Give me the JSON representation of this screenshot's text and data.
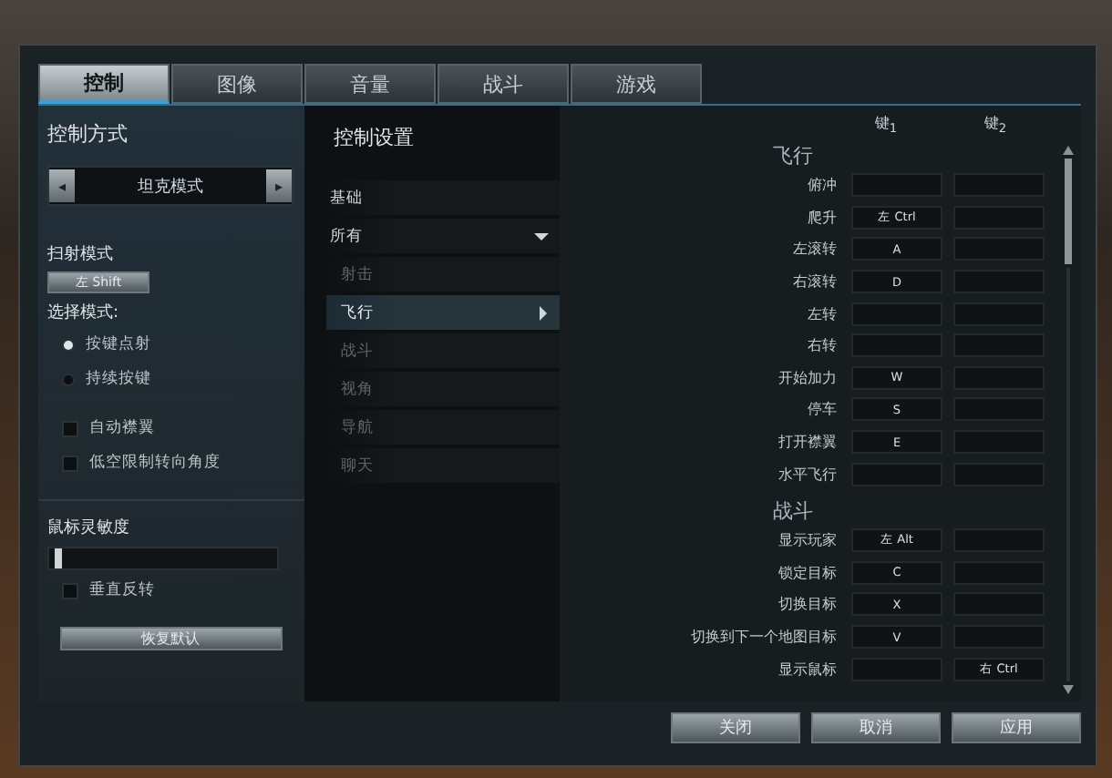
{
  "tabs": [
    {
      "label": "控制",
      "selected": true
    },
    {
      "label": "图像",
      "selected": false
    },
    {
      "label": "音量",
      "selected": false
    },
    {
      "label": "战斗",
      "selected": false
    },
    {
      "label": "游戏",
      "selected": false
    }
  ],
  "left": {
    "mode_title": "控制方式",
    "mode_prev": "◂",
    "mode_value": "坦克模式",
    "mode_next": "▸",
    "strafe_title": "扫射模式",
    "strafe_key": "左 Shift",
    "select_title": "选择模式:",
    "radios": [
      {
        "label": "按键点射",
        "selected": true
      },
      {
        "label": "持续按键",
        "selected": false
      }
    ],
    "checks": [
      {
        "label": "自动襟翼",
        "checked": false
      },
      {
        "label": "低空限制转向角度",
        "checked": false
      }
    ],
    "sensitivity_title": "鼠标灵敏度",
    "sensitivity": {
      "level": 0.02
    },
    "invert": {
      "label": "垂直反转",
      "checked": false
    },
    "reset": "恢复默认"
  },
  "middle": {
    "title": "控制设置",
    "items": [
      {
        "label": "基础",
        "selected": false
      },
      {
        "label": "所有",
        "selected": false,
        "expanded": true,
        "children": [
          {
            "label": "射击",
            "selected": false
          },
          {
            "label": "飞行",
            "selected": true
          },
          {
            "label": "战斗",
            "selected": false
          },
          {
            "label": "视角",
            "selected": false
          },
          {
            "label": "导航",
            "selected": false
          },
          {
            "label": "聊天",
            "selected": false
          }
        ]
      }
    ]
  },
  "bindings": {
    "columns": [
      "键$_{1}$",
      "键$_{2}$"
    ],
    "rows": [
      {
        "kind": "section",
        "label": "飞行"
      },
      {
        "kind": "bind",
        "label": "俯冲",
        "key1": "",
        "key2": ""
      },
      {
        "kind": "bind",
        "label": "爬升",
        "key1": "左 Ctrl",
        "key2": ""
      },
      {
        "kind": "bind",
        "label": "左滚转",
        "key1": "A",
        "key2": ""
      },
      {
        "kind": "bind",
        "label": "右滚转",
        "key1": "D",
        "key2": ""
      },
      {
        "kind": "bind",
        "label": "左转",
        "key1": "",
        "key2": ""
      },
      {
        "kind": "bind",
        "label": "右转",
        "key1": "",
        "key2": ""
      },
      {
        "kind": "bind",
        "label": "开始加力",
        "key1": "W",
        "key2": ""
      },
      {
        "kind": "bind",
        "label": "停车",
        "key1": "S",
        "key2": ""
      },
      {
        "kind": "bind",
        "label": "打开襟翼",
        "key1": "E",
        "key2": ""
      },
      {
        "kind": "bind",
        "label": "水平飞行",
        "key1": "",
        "key2": ""
      },
      {
        "kind": "section",
        "label": "战斗"
      },
      {
        "kind": "bind",
        "label": "显示玩家",
        "key1": "左 Alt",
        "key2": ""
      },
      {
        "kind": "bind",
        "label": "锁定目标",
        "key1": "C",
        "key2": ""
      },
      {
        "kind": "bind",
        "label": "切换目标",
        "key1": "X",
        "key2": ""
      },
      {
        "kind": "bind",
        "label": "切换到下一个地图目标",
        "key1": "V",
        "key2": ""
      },
      {
        "kind": "bind",
        "label": "显示鼠标",
        "key1": "",
        "key2": "右 Ctrl"
      }
    ]
  },
  "buttons": [
    "关闭",
    "取消",
    "应用"
  ]
}
